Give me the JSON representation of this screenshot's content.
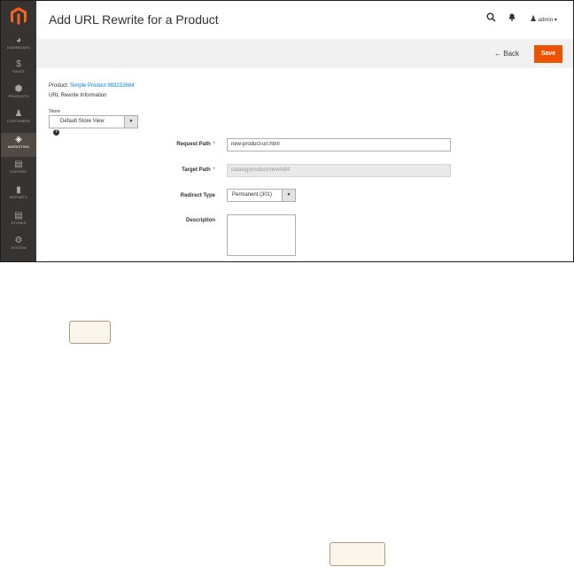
{
  "header": {
    "title": "Add URL Rewrite for a Product",
    "user": "admin"
  },
  "sidebar": {
    "items": [
      {
        "label": "DASHBOARD",
        "icon": "dashboard-icon"
      },
      {
        "label": "SALES",
        "icon": "dollar-icon"
      },
      {
        "label": "PRODUCTS",
        "icon": "box-icon"
      },
      {
        "label": "CUSTOMERS",
        "icon": "person-icon"
      },
      {
        "label": "MARKETING",
        "icon": "megaphone-icon"
      },
      {
        "label": "CONTENT",
        "icon": "content-icon"
      },
      {
        "label": "REPORTS",
        "icon": "bar-chart-icon"
      },
      {
        "label": "STORES",
        "icon": "store-icon"
      },
      {
        "label": "SYSTEM",
        "icon": "gear-icon"
      }
    ]
  },
  "actions": {
    "back": "Back",
    "save": "Save"
  },
  "product": {
    "label": "Product:",
    "name": "Simple Product 983232684",
    "section": "URL Rewrite Information"
  },
  "store": {
    "label": "Store",
    "value": "Default Store View"
  },
  "form": {
    "request_path_label": "Request Path",
    "request_path_value": "new-product-url.html",
    "target_path_label": "Target Path",
    "target_path_value": "catalog/product/view/id/4",
    "redirect_type_label": "Redirect Type",
    "redirect_type_value": "Permanent (301)",
    "description_label": "Description",
    "required_mark": "*"
  },
  "colors": {
    "sidebar": "#373330",
    "accent": "#eb5202",
    "link": "#007bdb"
  }
}
